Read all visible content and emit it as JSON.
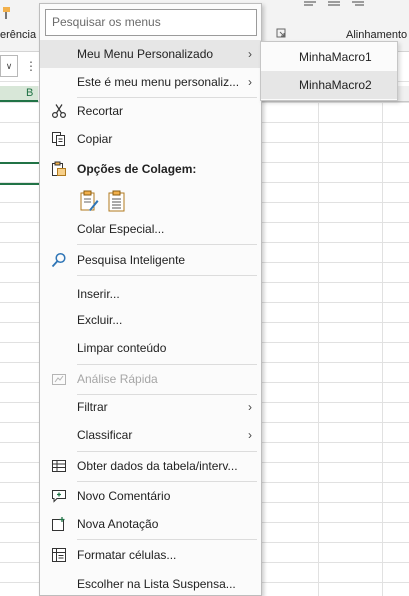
{
  "background": {
    "ribbon_left_label": "erência",
    "ribbon_right_label": "Alinhamento",
    "namebox_arrow": "∨",
    "column_b_header": "B",
    "accent_color": "#217346"
  },
  "menu": {
    "search_placeholder": "Pesquisar os menus",
    "items": [
      {
        "label": "Meu Menu Personalizado",
        "icon": "",
        "submenu": true
      },
      {
        "label": "Este é meu menu personaliz...",
        "icon": "",
        "submenu": true
      },
      {
        "label": "Recortar",
        "icon": "scissors-icon"
      },
      {
        "label": "Copiar",
        "icon": "copy-icon"
      },
      {
        "label": "Opções de Colagem:",
        "icon": "paste-icon",
        "header": true
      },
      {
        "label": "Colar Especial...",
        "icon": ""
      },
      {
        "label": "Pesquisa Inteligente",
        "icon": "search-icon"
      },
      {
        "label": "Inserir...",
        "icon": ""
      },
      {
        "label": "Excluir...",
        "icon": ""
      },
      {
        "label": "Limpar conteúdo",
        "icon": ""
      },
      {
        "label": "Análise Rápida",
        "icon": "quick-analysis-icon",
        "disabled": true
      },
      {
        "label": "Filtrar",
        "icon": "",
        "submenu": true
      },
      {
        "label": "Classificar",
        "icon": "",
        "submenu": true
      },
      {
        "label": "Obter dados da tabela/interv...",
        "icon": "table-icon"
      },
      {
        "label": "Novo Comentário",
        "icon": "comment-icon"
      },
      {
        "label": "Nova Anotação",
        "icon": "note-icon"
      },
      {
        "label": "Formatar células...",
        "icon": "format-cells-icon"
      },
      {
        "label": "Escolher na Lista Suspensa...",
        "icon": ""
      }
    ],
    "submenu_arrow": "›"
  },
  "submenu": {
    "items": [
      "MinhaMacro1",
      "MinhaMacro2"
    ]
  }
}
